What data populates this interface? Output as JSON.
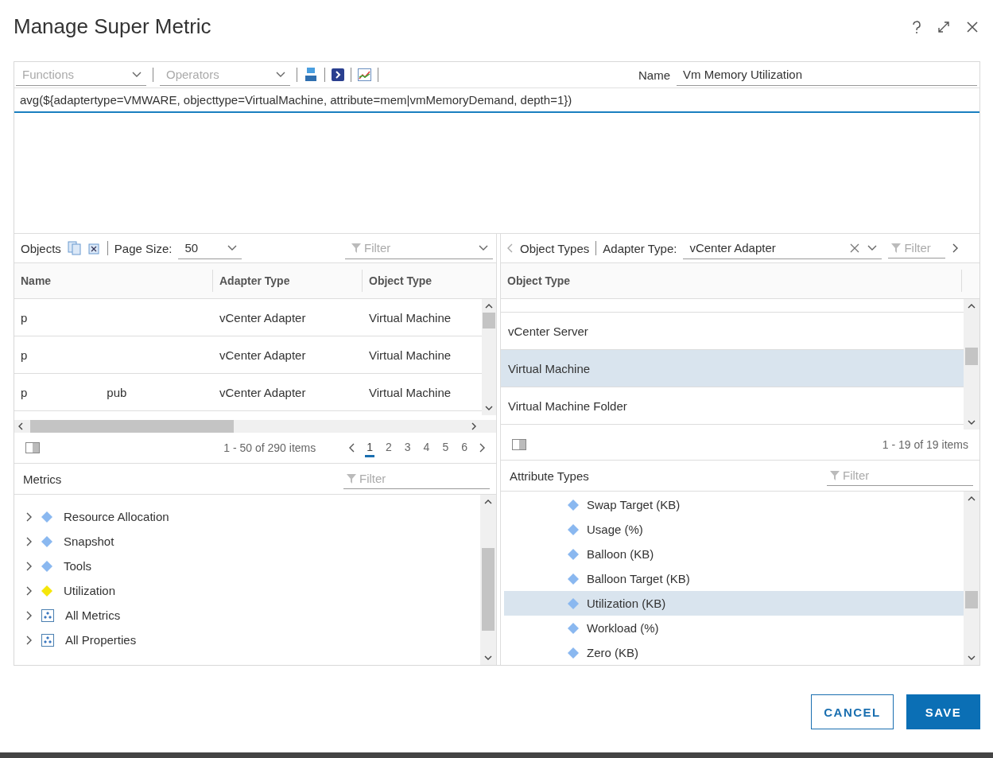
{
  "window": {
    "title": "Manage Super Metric"
  },
  "toolbar": {
    "functions": {
      "placeholder": "Functions"
    },
    "operators": {
      "placeholder": "Operators"
    },
    "name_label": "Name",
    "name_value": "Vm Memory Utilization"
  },
  "formula": "avg(${adaptertype=VMWARE, objecttype=VirtualMachine, attribute=mem|vmMemoryDemand, depth=1})",
  "objects": {
    "title": "Objects",
    "page_size_label": "Page Size:",
    "page_size": "50",
    "filter": {
      "placeholder": "Filter"
    },
    "columns": [
      "Name",
      "Adapter Type",
      "Object Type"
    ],
    "rows": [
      {
        "name": "p",
        "adapter_type": "vCenter Adapter",
        "object_type": "Virtual Machine"
      },
      {
        "name": "p",
        "adapter_type": "vCenter Adapter",
        "object_type": "Virtual Machine"
      },
      {
        "name": "p",
        "name_tail": "pub",
        "adapter_type": "vCenter Adapter",
        "object_type": "Virtual Machine"
      }
    ],
    "count": "1 - 50 of 290 items",
    "pages": [
      {
        "label": "1",
        "selected": true
      },
      {
        "label": "2",
        "selected": false
      },
      {
        "label": "3",
        "selected": false
      },
      {
        "label": "4",
        "selected": false
      },
      {
        "label": "5",
        "selected": false
      },
      {
        "label": "6",
        "selected": false
      }
    ]
  },
  "object_types": {
    "title": "Object Types",
    "adapter_label": "Adapter Type:",
    "adapter_value": "vCenter Adapter",
    "filter": {
      "placeholder": "Filter"
    },
    "column": "Object Type",
    "rows": [
      {
        "label": "vCenter Server",
        "selected": false
      },
      {
        "label": "Virtual Machine",
        "selected": true
      },
      {
        "label": "Virtual Machine Folder",
        "selected": false
      }
    ],
    "count": "1 - 19 of 19 items"
  },
  "metrics": {
    "title": "Metrics",
    "filter": {
      "placeholder": "Filter"
    },
    "items": [
      {
        "label": "Resource Allocation",
        "kind": "diamond",
        "color": "#8ab8f0"
      },
      {
        "label": "Snapshot",
        "kind": "diamond",
        "color": "#8ab8f0"
      },
      {
        "label": "Tools",
        "kind": "diamond",
        "color": "#8ab8f0"
      },
      {
        "label": "Utilization",
        "kind": "diamond",
        "color": "#f5e60a"
      },
      {
        "label": "All Metrics",
        "kind": "group"
      },
      {
        "label": "All Properties",
        "kind": "group"
      }
    ]
  },
  "attributes": {
    "title": "Attribute Types",
    "filter": {
      "placeholder": "Filter"
    },
    "items": [
      {
        "label": "Swap Target (KB)",
        "selected": false
      },
      {
        "label": "Usage (%)",
        "selected": false
      },
      {
        "label": "Balloon (KB)",
        "selected": false
      },
      {
        "label": "Balloon Target (KB)",
        "selected": false
      },
      {
        "label": "Utilization (KB)",
        "selected": true
      },
      {
        "label": "Workload (%)",
        "selected": false
      },
      {
        "label": "Zero (KB)",
        "selected": false
      }
    ]
  },
  "buttons": {
    "cancel": "CANCEL",
    "save": "SAVE"
  }
}
